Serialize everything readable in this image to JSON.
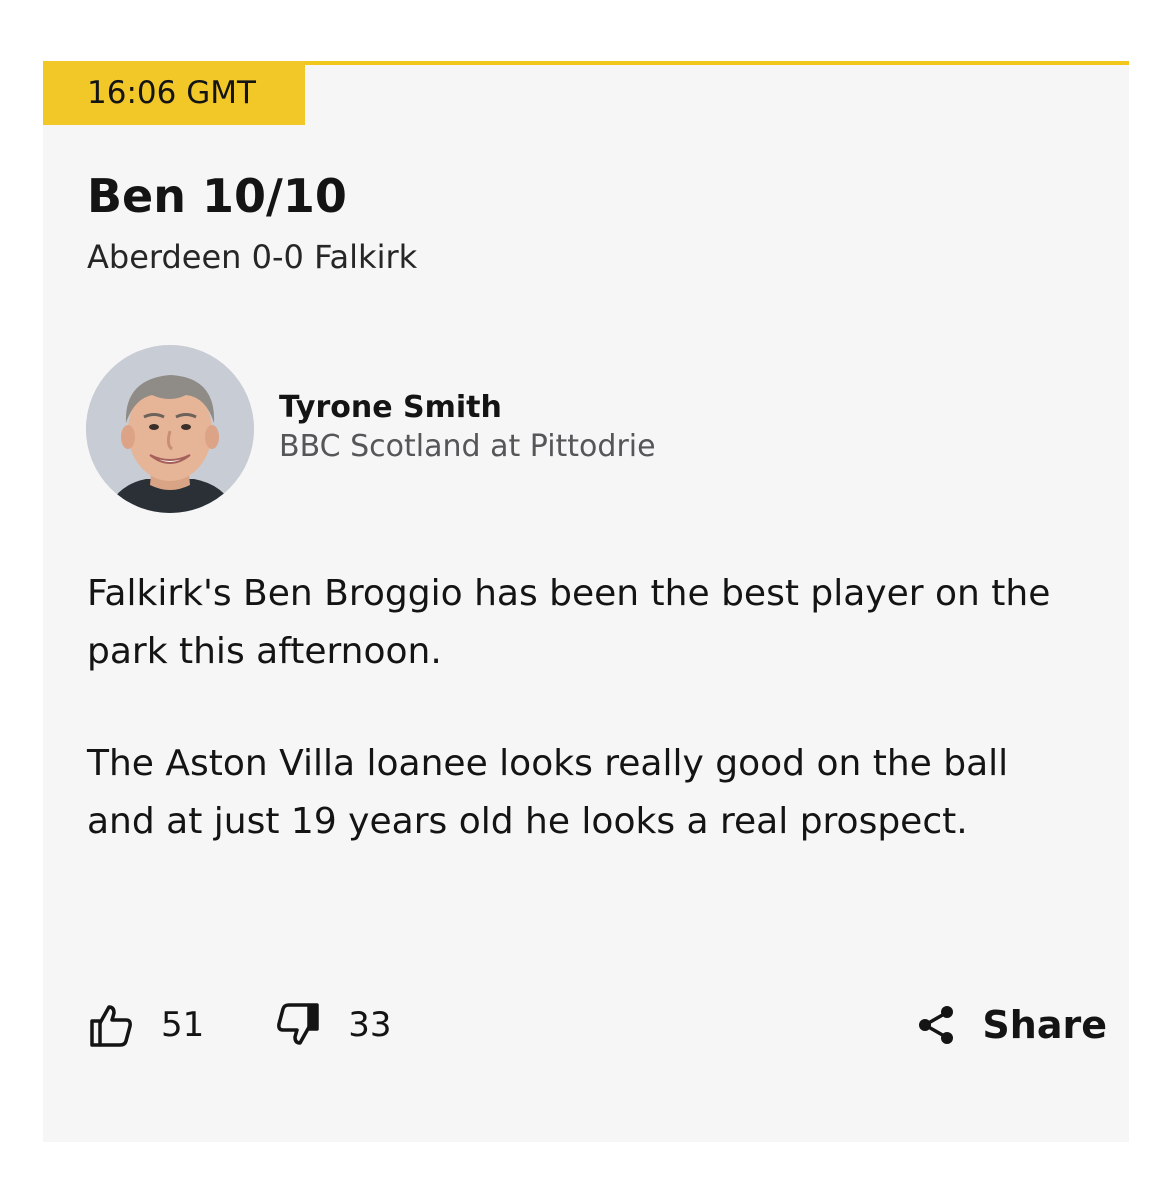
{
  "post": {
    "timestamp": "16:06 GMT",
    "headline": "Ben 10/10",
    "subheadline": "Aberdeen 0-0 Falkirk",
    "author": {
      "name": "Tyrone Smith",
      "role": "BBC Scotland at Pittodrie"
    },
    "paragraphs": [
      "Falkirk's Ben Broggio has been the best player on the park this afternoon.",
      "The Aston Villa loanee looks really good on the ball and at just 19 years old he looks a real prospect."
    ]
  },
  "reactions": {
    "likes": "51",
    "dislikes": "33",
    "share_label": "Share"
  },
  "icons": {
    "like": "thumbs-up-icon",
    "dislike": "thumbs-down-icon",
    "share": "share-icon"
  },
  "colors": {
    "accent": "#f2c829",
    "card_background": "#f6f6f6",
    "text": "#141414",
    "muted_text": "#545658"
  }
}
